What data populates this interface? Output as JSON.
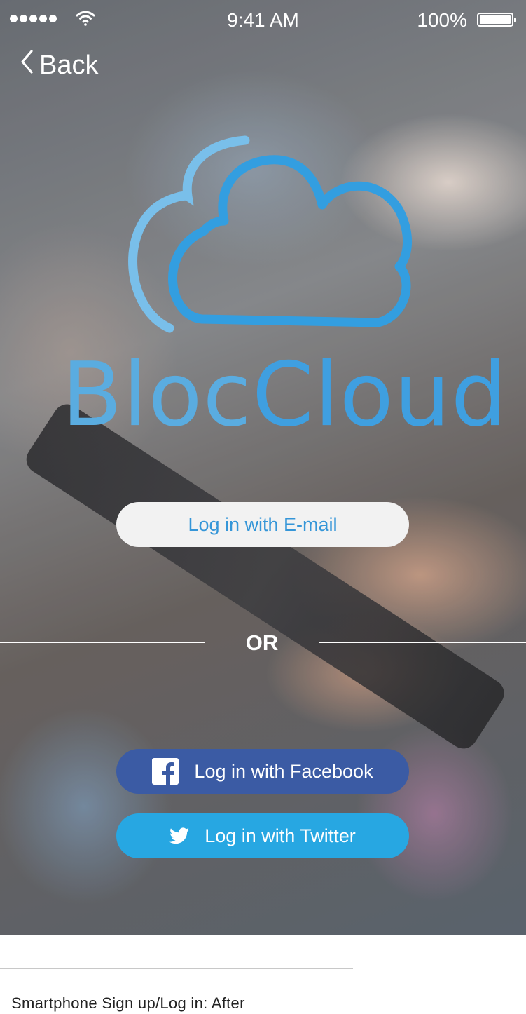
{
  "status_bar": {
    "time": "9:41 AM",
    "battery_percent": "100%",
    "battery_level": 1.0,
    "signal_bars": 5
  },
  "nav": {
    "back_label": "Back"
  },
  "brand": {
    "name_part1": "Bloc",
    "name_part2": "Cloud",
    "colors": {
      "light": "#5aace0",
      "main": "#3f9fe0"
    }
  },
  "auth": {
    "email_label": "Log in with E-mail",
    "divider_label": "OR",
    "facebook_label": "Log in with Facebook",
    "twitter_label": "Log in with Twitter",
    "colors": {
      "facebook": "#3b5ba4",
      "twitter": "#27a7e2",
      "email_text": "#3596d8"
    }
  },
  "caption": "Smartphone Sign up/Log in: After",
  "icons": {
    "back": "chevron-left-icon",
    "facebook": "facebook-icon",
    "twitter": "twitter-icon",
    "wifi": "wifi-icon",
    "battery": "battery-icon",
    "logo": "cloud-logo-icon"
  }
}
